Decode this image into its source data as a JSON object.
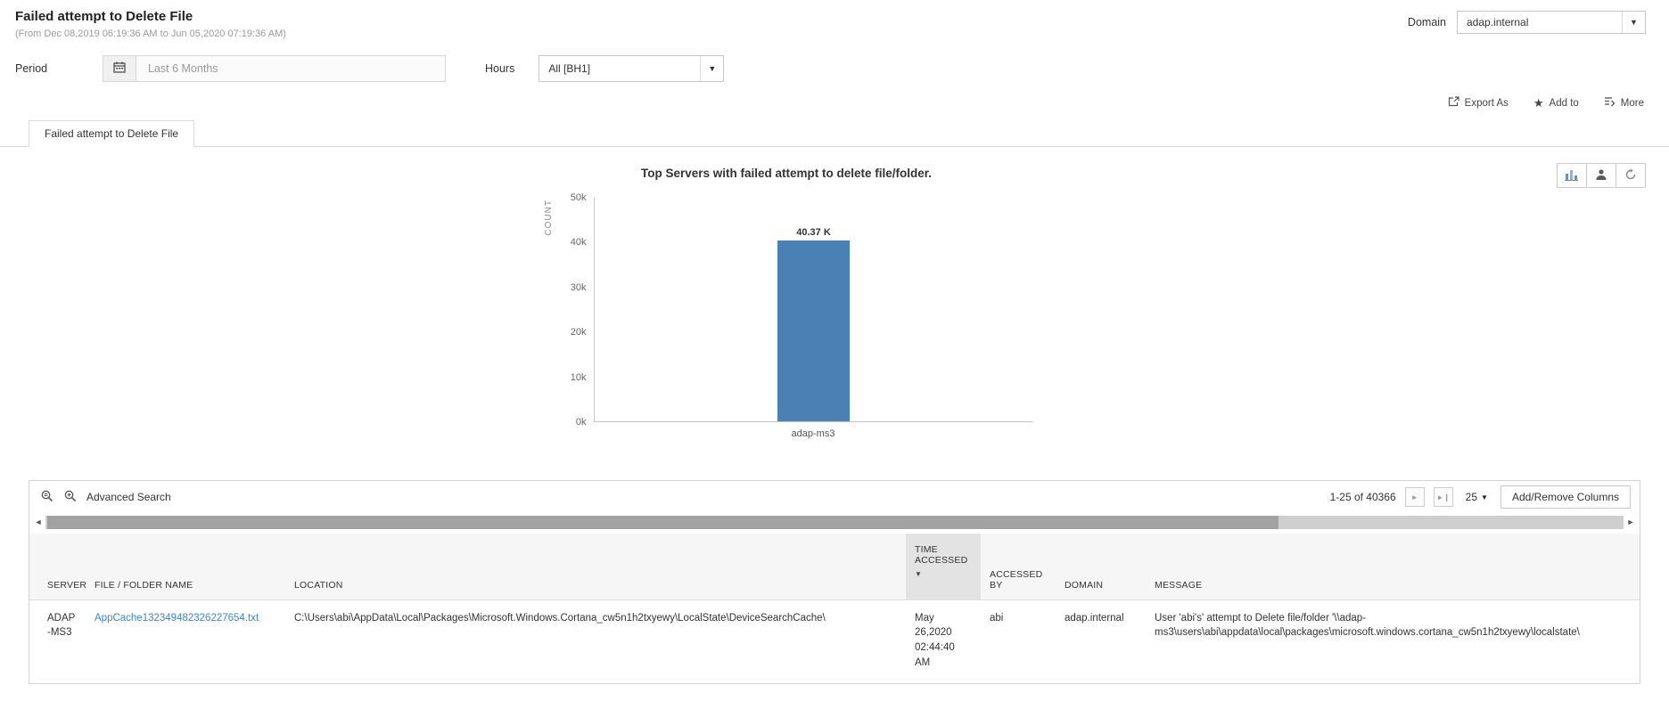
{
  "header": {
    "title": "Failed attempt to Delete File",
    "subtitle": "(From Dec 08,2019 06:19:36 AM to Jun 05,2020 07:19:36 AM)",
    "domain_label": "Domain",
    "domain_value": "adap.internal"
  },
  "filters": {
    "period_label": "Period",
    "period_value": "Last 6 Months",
    "hours_label": "Hours",
    "hours_value": "All [BH1]"
  },
  "actions": {
    "export_as": "Export As",
    "add_to": "Add to",
    "more": "More"
  },
  "tabs": [
    {
      "label": "Failed attempt to Delete File",
      "active": true
    }
  ],
  "chart_data": {
    "type": "bar",
    "title": "Top Servers with failed attempt to delete file/folder.",
    "xlabel": "",
    "ylabel": "COUNT",
    "categories": [
      "adap-ms3"
    ],
    "values": [
      40370
    ],
    "value_labels": [
      "40.37 K"
    ],
    "ylim": [
      0,
      50000
    ],
    "yticks": [
      "50k",
      "40k",
      "30k",
      "20k",
      "10k",
      "0k"
    ],
    "bar_color": "#4a81b5",
    "grid": false,
    "legend": false
  },
  "table": {
    "toolbar": {
      "advanced_search_label": "Advanced Search",
      "pagination_text": "1-25 of 40366",
      "page_size": "25",
      "add_remove_columns_label": "Add/Remove Columns"
    },
    "columns": [
      "SERVER",
      "FILE / FOLDER NAME",
      "LOCATION",
      "TIME ACCESSED",
      "ACCESSED BY",
      "DOMAIN",
      "MESSAGE"
    ],
    "sorted_column": "TIME ACCESSED",
    "sort_direction": "desc",
    "rows": [
      {
        "server": "ADAP-MS3",
        "file_folder_name": "AppCache132349482326227654.txt",
        "location": "C:\\Users\\abi\\AppData\\Local\\Packages\\Microsoft.Windows.Cortana_cw5n1h2txyewy\\LocalState\\DeviceSearchCache\\",
        "time_accessed": "May 26,2020 02:44:40 AM",
        "accessed_by": "abi",
        "domain": "adap.internal",
        "message": "User 'abi's' attempt to Delete file/folder '\\\\adap-ms3\\users\\abi\\appdata\\local\\packages\\microsoft.windows.cortana_cw5n1h2txyewy\\localstate\\"
      }
    ]
  }
}
